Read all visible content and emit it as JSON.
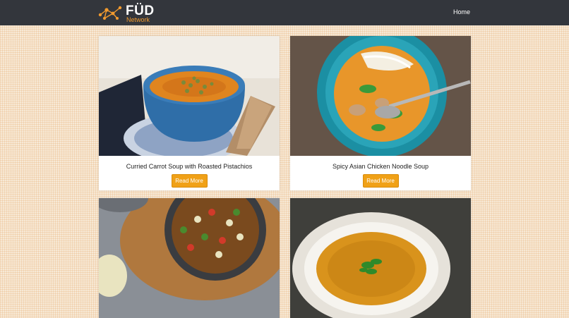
{
  "brand": {
    "name": "FÜD",
    "sub": "Network",
    "logo_icon": "network-nodes-icon"
  },
  "nav": {
    "home_label": "Home"
  },
  "cards": [
    {
      "title": "Curried Carrot Soup with Roasted Pistachios",
      "button_label": "Read More"
    },
    {
      "title": "Spicy Asian Chicken Noodle Soup",
      "button_label": "Read More"
    },
    {
      "title": "",
      "button_label": ""
    },
    {
      "title": "",
      "button_label": ""
    }
  ],
  "colors": {
    "navbar": "#33363c",
    "accent": "#f0a117",
    "background": "#f7e9d6"
  }
}
